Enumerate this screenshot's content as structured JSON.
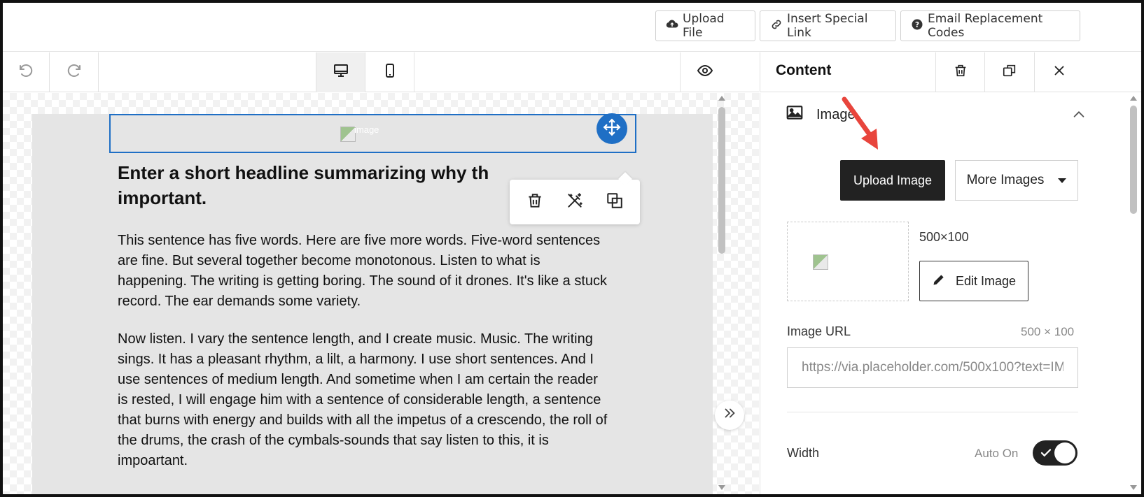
{
  "topbar": {
    "upload_file": "Upload File",
    "insert_special_link": "Insert Special Link",
    "email_replacement_codes": "Email Replacement Codes"
  },
  "canvas": {
    "image_alt": "image",
    "headline": "Enter a short headline summarizing why th… important.",
    "headline_line1": "Enter a short headline summarizing why th",
    "headline_line2": "important.",
    "paragraph1": "This sentence has five words. Here are five more words. Five-word sentences are fine. But several together become monotonous. Listen to what is happening. The writing is getting boring. The sound of it drones. It's like a stuck record. The ear demands some variety.",
    "paragraph2": "Now listen. I vary the sentence length, and I create music. Music. The writing sings. It has a pleasant rhythm, a lilt, a harmony. I use short sentences. And I use sentences of medium length. And sometime when I am certain the reader is rested, I will engage him with a sentence of considerable length, a sentence that burns with energy and builds with all the impetus of a crescendo, the roll of the drums, the crash of the cymbals-sounds that say listen to this, it is impoartant."
  },
  "panel": {
    "title": "Content",
    "section_title": "Image",
    "upload_image": "Upload Image",
    "more_images": "More Images",
    "image_dimensions": "500×100",
    "edit_image": "Edit Image",
    "image_url_label": "Image URL",
    "image_url_hint": "500 × 100",
    "image_url_value": "https://via.placeholder.com/500x100?text=IM",
    "width_label": "Width",
    "width_auto": "Auto On",
    "width_auto_on": true
  },
  "colors": {
    "accent_blue": "#1f6fc5",
    "dark_button": "#222222",
    "annotation_arrow": "#e8453c"
  }
}
